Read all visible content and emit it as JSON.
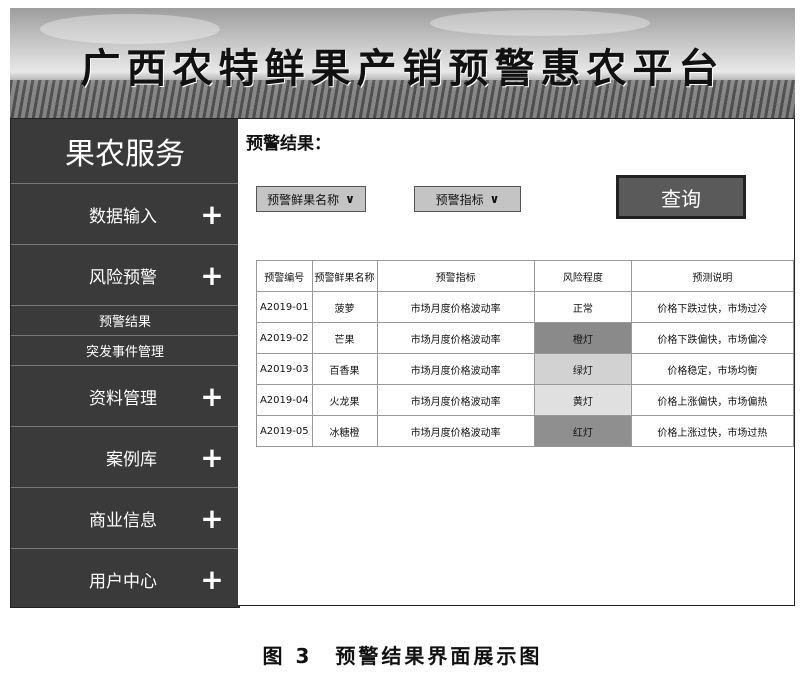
{
  "banner": {
    "title": "广西农特鲜果产销预警惠农平台"
  },
  "sidebar": {
    "header": "果农服务",
    "items": [
      {
        "label": "数据输入",
        "icon": "plus-icon"
      },
      {
        "label": "风险预警",
        "icon": "plus-icon"
      },
      {
        "label": "预警结果",
        "sub": true
      },
      {
        "label": "突发事件管理",
        "sub": true
      },
      {
        "label": "资料管理",
        "icon": "plus-icon"
      },
      {
        "label": "案例库",
        "icon": "plus-icon"
      },
      {
        "label": "商业信息",
        "icon": "plus-icon"
      },
      {
        "label": "用户中心",
        "icon": "plus-icon"
      }
    ]
  },
  "main": {
    "result_label": "预警结果：",
    "fruit_dropdown": "预警鲜果名称",
    "indicator_dropdown": "预警指标",
    "query_button": "查询",
    "table": {
      "headers": [
        "预警编号",
        "预警鲜果名称",
        "预警指标",
        "风险程度",
        "预测说明"
      ],
      "rows": [
        [
          "A2019-01",
          "菠萝",
          "市场月度价格波动率",
          "正常",
          "价格下跌过快，市场过冷"
        ],
        [
          "A2019-02",
          "芒果",
          "市场月度价格波动率",
          "橙灯",
          "价格下跌偏快，市场偏冷"
        ],
        [
          "A2019-03",
          "百香果",
          "市场月度价格波动率",
          "绿灯",
          "价格稳定，市场均衡"
        ],
        [
          "A2019-04",
          "火龙果",
          "市场月度价格波动率",
          "黄灯",
          "价格上涨偏快，市场偏热"
        ],
        [
          "A2019-05",
          "冰糖橙",
          "市场月度价格波动率",
          "红灯",
          "价格上涨过快，市场过热"
        ]
      ],
      "risk_shades": [
        "#ffffff",
        "#8a8a8a",
        "#d2d2d2",
        "#e0e0e0",
        "#8f8f8f"
      ]
    }
  },
  "caption": "图 3　预警结果界面展示图",
  "colors": {
    "sidebar_bg": "#3a3a3a",
    "button_bg": "#5a5a5a",
    "dropdown_bg": "#c4c4c4"
  }
}
